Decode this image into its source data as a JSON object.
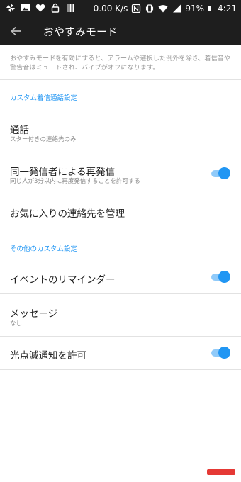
{
  "status_bar": {
    "network_speed": "0.00 K/s",
    "battery": "91%",
    "time": "4:21"
  },
  "app_bar": {
    "title": "おやすみモード"
  },
  "description": "おやすみモードを有効にすると、アラームや選択した例外を除き、着信音や警告音はミュートされ、バイブがオフになります。",
  "sections": [
    {
      "header": "カスタム着信通話設定",
      "items": [
        {
          "title": "通話",
          "subtitle": "スター付きの連絡先のみ",
          "toggle": null
        },
        {
          "title": "同一発信者による再発信",
          "subtitle": "同じ人が3分以内に再度発信することを許可する",
          "toggle": true
        },
        {
          "title": "お気に入りの連絡先を管理",
          "subtitle": null,
          "toggle": null
        }
      ]
    },
    {
      "header": "その他のカスタム設定",
      "items": [
        {
          "title": "イベントのリマインダー",
          "subtitle": null,
          "toggle": true
        },
        {
          "title": "メッセージ",
          "subtitle": "なし",
          "toggle": null
        },
        {
          "title": "光点滅通知を許可",
          "subtitle": null,
          "toggle": true
        }
      ]
    }
  ],
  "colors": {
    "accent": "#2196f3",
    "bar_background": "#1e1e1e"
  }
}
